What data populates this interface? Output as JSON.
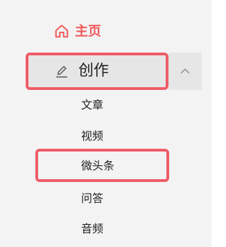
{
  "nav": {
    "home": {
      "label": "主页",
      "icon": "home-icon",
      "color": "#f05a5a"
    },
    "create": {
      "label": "创作",
      "icon": "pen-icon",
      "expanded": true,
      "chevron": "chevron-up-icon"
    },
    "submenu": [
      {
        "label": "文章"
      },
      {
        "label": "视频"
      },
      {
        "label": "微头条"
      },
      {
        "label": "问答"
      },
      {
        "label": "音频"
      }
    ]
  },
  "colors": {
    "accent": "#f05a5a",
    "annotation_border": "#ef5b67",
    "panel_bg": "#f3f3f3",
    "active_bg": "#e6e6e6",
    "text": "#222222"
  }
}
